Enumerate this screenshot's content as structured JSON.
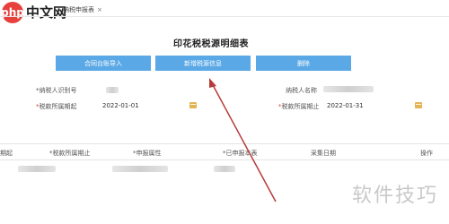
{
  "site_logo": {
    "badge": "php",
    "name": "中文网"
  },
  "tab": {
    "label": "纳税申报表",
    "close": "×"
  },
  "page": {
    "title": "印花税税源明细表"
  },
  "toolbar": {
    "btn1": "合同台账导入",
    "btn2": "新增税源信息",
    "btn3": "删除"
  },
  "form": {
    "taxpayer_id_label": "*纳税人识别号",
    "taxpayer_name_label": "纳税人名称",
    "period_start_label": "*税款所属期起",
    "period_start_value": "2022-01-01",
    "period_end_label": "*税款所属期止",
    "period_end_value": "2022-01-31"
  },
  "table": {
    "headers": [
      "期起",
      "*税款所属期止",
      "*申报属性",
      "*已申报本表",
      "采集日期",
      "操作"
    ]
  },
  "watermark": "软件技巧"
}
